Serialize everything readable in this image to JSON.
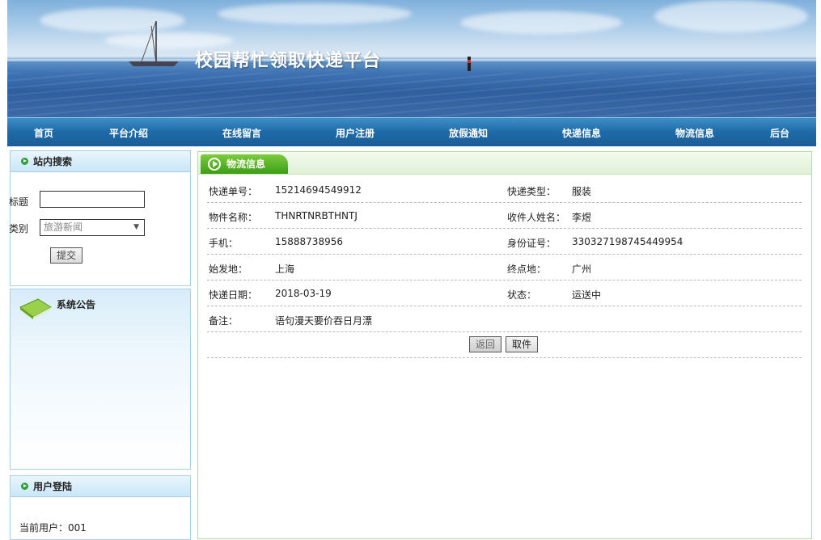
{
  "banner": {
    "title": "校园帮忙领取快递平台"
  },
  "nav": {
    "items": [
      "首页",
      "平台介绍",
      "在线留言",
      "用户注册",
      "放假通知",
      "快递信息",
      "物流信息",
      "后台"
    ]
  },
  "search_panel": {
    "title": "站内搜索",
    "title_label": "标题",
    "title_value": "",
    "category_label": "类别",
    "category_selected": "旅游新闻",
    "submit_label": "提交"
  },
  "notice_panel": {
    "title": "系统公告"
  },
  "login_panel": {
    "title": "用户登陆",
    "current_user": "当前用户：001"
  },
  "detail": {
    "tab_title": "物流信息",
    "rows": [
      {
        "l1": "快递单号：",
        "v1": "15214694549912",
        "l2": "快递类型：",
        "v2": "服装"
      },
      {
        "l1": "物件名称：",
        "v1": "THNRTNRBTHNTJ",
        "l2": "收件人姓名：",
        "v2": "李煜"
      },
      {
        "l1": "手机：",
        "v1": "15888738956",
        "l2": "身份证号：",
        "v2": "330327198745449954"
      },
      {
        "l1": "始发地：",
        "v1": "上海",
        "l2": "终点地：",
        "v2": "广州"
      },
      {
        "l1": "快递日期：",
        "v1": "2018-03-19",
        "l2": "状态：",
        "v2": "运送中"
      }
    ],
    "remark_label": "备注：",
    "remark_value": "语句漫天要价吞日月漂",
    "back_label": "返回",
    "pickup_label": "取件"
  }
}
